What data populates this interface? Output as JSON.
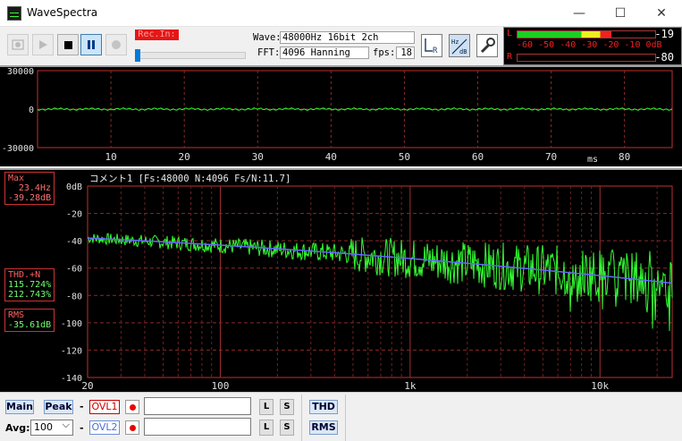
{
  "window": {
    "title": "WaveSpectra",
    "minimize": "—",
    "maximize": "☐",
    "close": "✕"
  },
  "toolbar": {
    "rec_label": "Rec.In:",
    "wave_label": "Wave:",
    "wave_value": "48000Hz 16bit 2ch",
    "fft_label": "FFT:",
    "fft_value": "4096 Hanning",
    "fps_label": "fps:",
    "fps_value": "18",
    "icons": [
      "settings-icon",
      "play-icon",
      "stop-icon",
      "pause-icon",
      "record-icon",
      "lr-icon",
      "hz-db-icon",
      "wrench-icon"
    ]
  },
  "meter": {
    "left_label": "L",
    "right_label": "R",
    "scale": "-60 -50 -40 -30 -20 -10 0dB",
    "left_value": "-19",
    "right_value": "-80",
    "left_level_db": -19,
    "right_level_db": -80
  },
  "wave": {
    "y_ticks": [
      "30000",
      "0",
      "-30000"
    ],
    "x_ticks": [
      "10",
      "20",
      "30",
      "40",
      "50",
      "60",
      "70",
      "80"
    ],
    "x_unit": "ms",
    "color": "#33ff33"
  },
  "spectrum": {
    "comment": "コメント1  [Fs:48000 N:4096 Fs/N:11.7]",
    "y_ticks": [
      "0dB",
      "-20",
      "-40",
      "-60",
      "-80",
      "-100",
      "-120",
      "-140"
    ],
    "x_ticks": [
      "20",
      "100",
      "1k",
      "10k"
    ],
    "max_label": "Max",
    "max_freq": "23.4Hz",
    "max_db": "-39.28dB",
    "thd_label": "THD.+N",
    "thd_l": "115.724%",
    "thd_r": "212.743%",
    "rms_label": "RMS",
    "rms_value": "-35.61dB",
    "series_colors": {
      "left": "#33ff33",
      "average": "#6666ff"
    }
  },
  "bottom": {
    "main": "Main",
    "peak": "Peak",
    "dash1": "-",
    "ovl1": "OVL1",
    "avg_label": "Avg:",
    "avg_value": "100",
    "dash2": "-",
    "ovl2": "OVL2",
    "l1": "L",
    "s1": "S",
    "l2": "L",
    "s2": "S",
    "thd": "THD",
    "rms": "RMS"
  }
}
